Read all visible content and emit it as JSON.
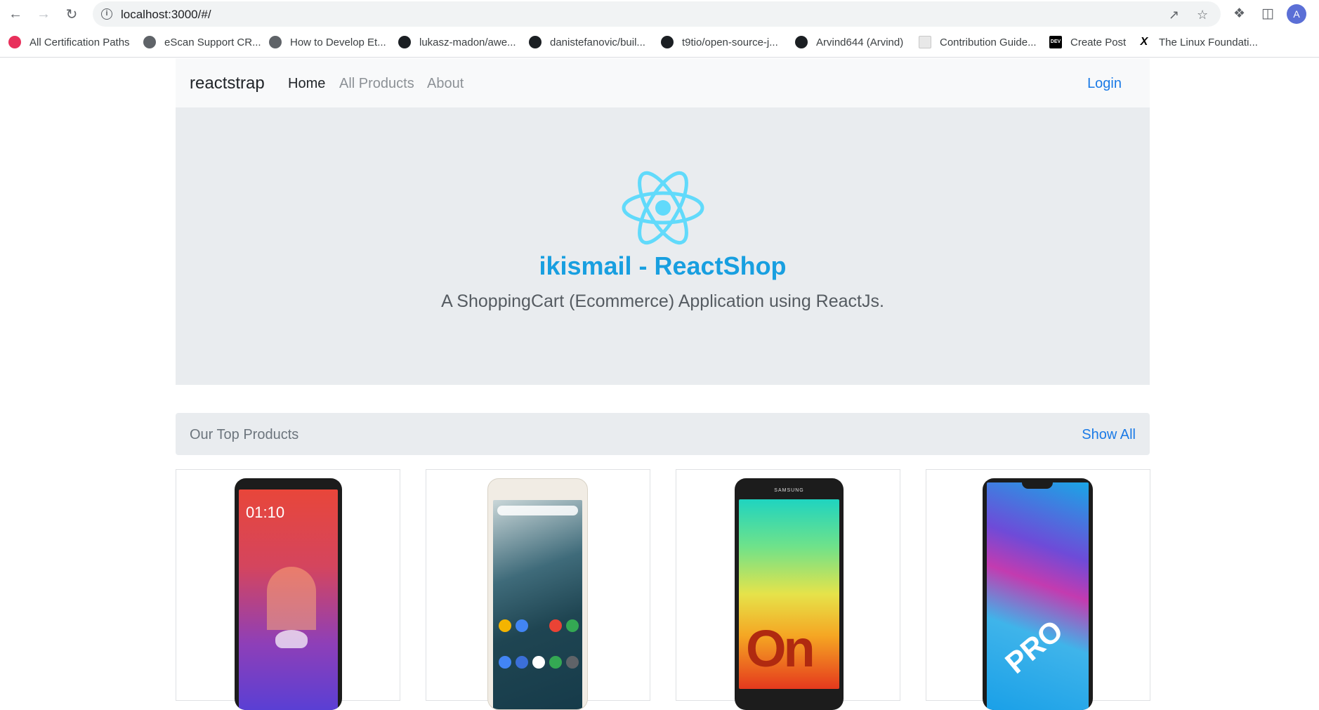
{
  "browser": {
    "url": "localhost:3000/#/",
    "bookmarks": [
      {
        "label": "All Certification Paths",
        "icon": "certification-icon"
      },
      {
        "label": "eScan Support CR...",
        "icon": "globe-icon"
      },
      {
        "label": "How to Develop Et...",
        "icon": "globe-icon"
      },
      {
        "label": "lukasz-madon/awe...",
        "icon": "github-icon"
      },
      {
        "label": "danistefanovic/buil...",
        "icon": "github-icon"
      },
      {
        "label": "t9tio/open-source-j...",
        "icon": "github-icon"
      },
      {
        "label": "Arvind644 (Arvind)",
        "icon": "github-icon"
      },
      {
        "label": "Contribution Guide...",
        "icon": "document-icon"
      },
      {
        "label": "Create Post",
        "icon": "dev-icon"
      },
      {
        "label": "The Linux Foundati...",
        "icon": "linux-foundation-icon"
      }
    ],
    "profile_initial": "A"
  },
  "navbar": {
    "brand": "reactstrap",
    "links": [
      "Home",
      "All Products",
      "About"
    ],
    "active": "Home",
    "login": "Login"
  },
  "hero": {
    "title": "ikismail - ReactShop",
    "subtitle": "A ShoppingCart (Ecommerce) Application using ReactJs.",
    "logo": "react-logo-icon"
  },
  "products_section": {
    "title": "Our Top Products",
    "show_all": "Show All"
  },
  "products": [
    {
      "image": "oppo-phone-image",
      "screen_text": "01:10"
    },
    {
      "image": "xiaomi-phone-image"
    },
    {
      "image": "samsung-galaxy-on-phone-image",
      "brand_text": "SAMSUNG",
      "screen_text": "On"
    },
    {
      "image": "vivo-pro-phone-image",
      "screen_text": "PRO"
    }
  ],
  "colors": {
    "accent": "#1a7ae6",
    "hero_title": "#189fe0",
    "react_logo": "#61dafb",
    "jumbotron_bg": "#e9ecef"
  }
}
